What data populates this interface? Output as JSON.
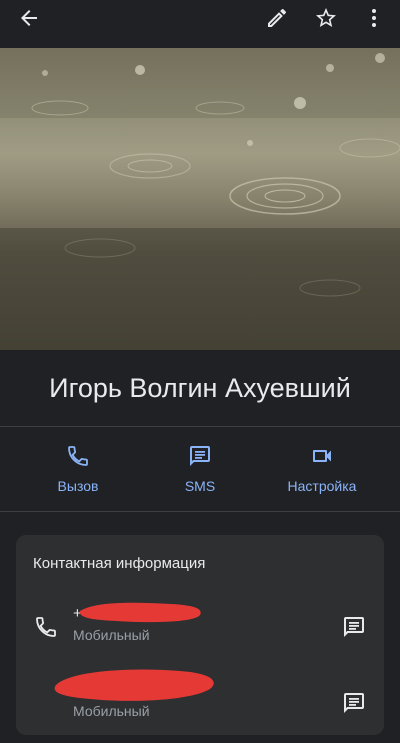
{
  "contact": {
    "name": "Игорь Волгин Ахуевший"
  },
  "actions": [
    {
      "label": "Вызов",
      "icon": "phone-icon"
    },
    {
      "label": "SMS",
      "icon": "message-icon"
    },
    {
      "label": "Настройка",
      "icon": "video-call-icon"
    }
  ],
  "card": {
    "title": "Контактная информация",
    "entries": [
      {
        "number_visible": "+",
        "type": "Мобильный",
        "redacted": true
      },
      {
        "number_visible": "",
        "type": "Мобильный",
        "redacted": true
      }
    ]
  },
  "colors": {
    "background": "#202124",
    "card": "#2d2f31",
    "accent": "#8ab4f8",
    "redaction": "#e53935"
  }
}
